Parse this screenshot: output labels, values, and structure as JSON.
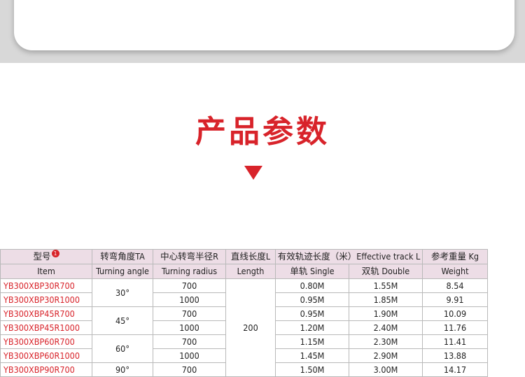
{
  "section_title": "产品参数",
  "table": {
    "headers": {
      "item_cn": "型号",
      "item_note": "1",
      "item_en": "Item",
      "angle_cn": "转弯角度TA",
      "angle_en": "Turning angle",
      "radius_cn": "中心转弯半径R",
      "radius_en": "Turning radius",
      "length_cn": "直线长度L",
      "length_en": "Length",
      "track_cn": "有效轨迹长度（米）Effective track L",
      "single": "单轨 Single",
      "double": "双轨 Double",
      "weight_cn": "参考重量 Kg",
      "weight_en": "Weight"
    },
    "length_value": "200",
    "groups": [
      {
        "angle": "30°",
        "rows": [
          {
            "model": "YB300XBP30R700",
            "radius": "700",
            "single": "0.80M",
            "double": "1.55M",
            "weight": "8.54"
          },
          {
            "model": "YB300XBP30R1000",
            "radius": "1000",
            "single": "0.95M",
            "double": "1.85M",
            "weight": "9.91"
          }
        ]
      },
      {
        "angle": "45°",
        "rows": [
          {
            "model": "YB300XBP45R700",
            "radius": "700",
            "single": "0.95M",
            "double": "1.90M",
            "weight": "10.09"
          },
          {
            "model": "YB300XBP45R1000",
            "radius": "1000",
            "single": "1.20M",
            "double": "2.40M",
            "weight": "11.76"
          }
        ]
      },
      {
        "angle": "60°",
        "rows": [
          {
            "model": "YB300XBP60R700",
            "radius": "700",
            "single": "1.15M",
            "double": "2.30M",
            "weight": "11.41"
          },
          {
            "model": "YB300XBP60R1000",
            "radius": "1000",
            "single": "1.45M",
            "double": "2.90M",
            "weight": "13.88"
          }
        ]
      },
      {
        "angle": "90°",
        "rows": [
          {
            "model": "YB300XBP90R700",
            "radius": "700",
            "single": "1.50M",
            "double": "3.00M",
            "weight": "14.17"
          }
        ]
      }
    ]
  }
}
